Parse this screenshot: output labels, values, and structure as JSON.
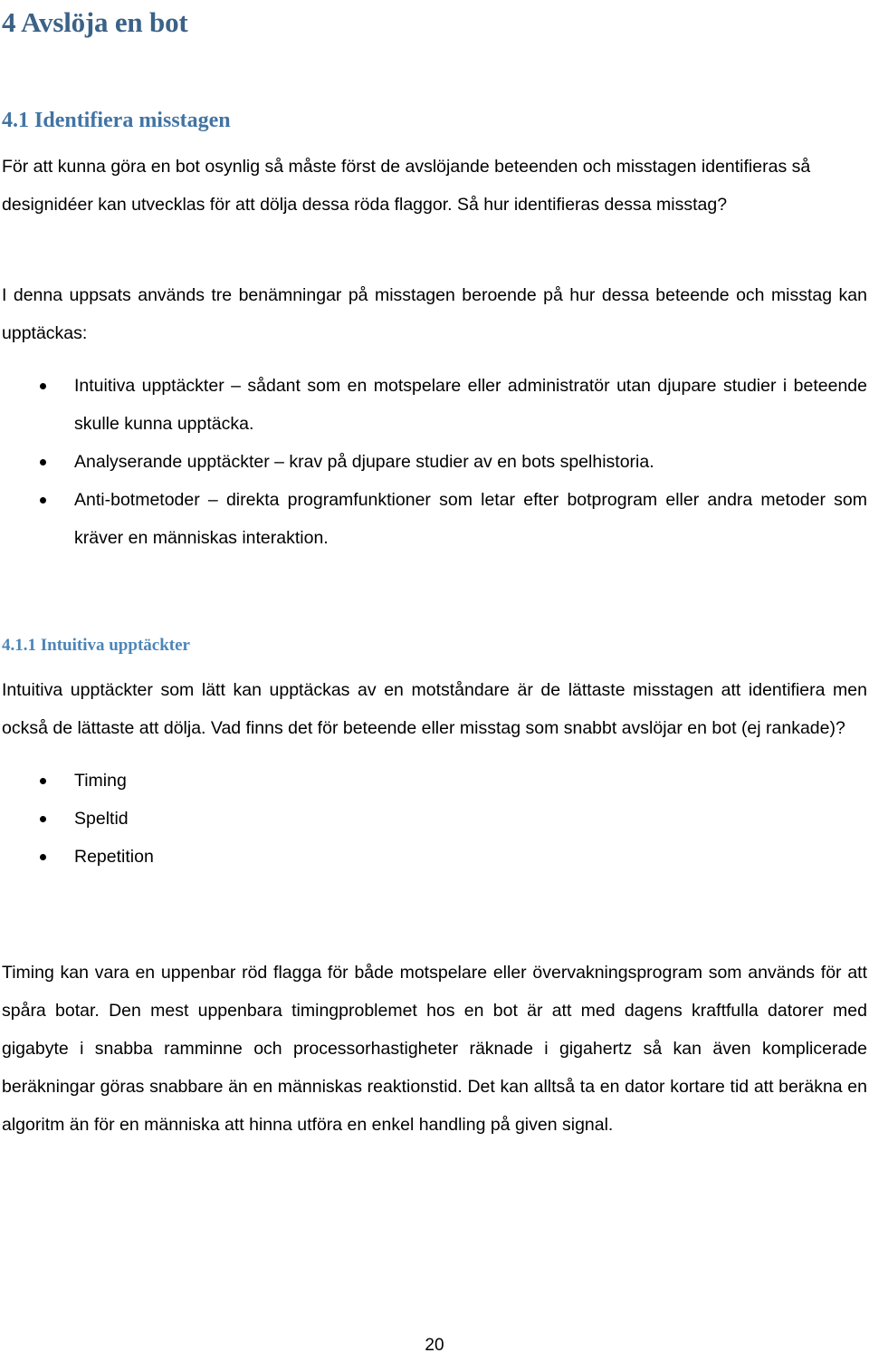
{
  "document": {
    "page_number": "20",
    "colors": {
      "heading_level1": "#3b6287",
      "heading_level2": "#4274a3",
      "heading_level3": "#4c85b8",
      "body_text": "#000000",
      "page_background": "#ffffff"
    }
  },
  "headings": {
    "chapter": "4 Avslöja en bot",
    "section": "4.1 Identifiera misstagen",
    "subsection": "4.1.1 Intuitiva upptäckter"
  },
  "paragraphs": {
    "intro": "För att kunna göra en bot osynlig så måste först de avslöjande beteenden och misstagen identifieras så designidéer kan utvecklas för att dölja dessa röda flaggor. Så hur identifieras dessa misstag?",
    "terms_lead": "I denna uppsats används tre benämningar på misstagen beroende på hur dessa beteende och misstag kan upptäckas:",
    "intuitive_intro": "Intuitiva upptäckter som lätt kan upptäckas av en motståndare är de lättaste misstagen att identifiera men också de lättaste att dölja. Vad finns det för beteende eller misstag som snabbt avslöjar en bot (ej rankade)?",
    "timing_discussion": "Timing kan vara en uppenbar röd flagga för både motspelare eller övervakningsprogram som används för att spåra botar. Den mest uppenbara timingproblemet hos en bot är att med dagens kraftfulla datorer med gigabyte i snabba ramminne och processorhastigheter räknade i gigahertz så kan även komplicerade beräkningar göras snabbare än en människas reaktionstid. Det kan alltså ta en dator kortare tid att beräkna en algoritm än för en människa att hinna utföra en enkel handling på given signal."
  },
  "lists": {
    "detection_types": [
      "Intuitiva upptäckter – sådant som en motspelare eller administratör utan djupare studier i beteende skulle kunna upptäcka.",
      "Analyserande upptäckter – krav på djupare studier av en bots spelhistoria.",
      "Anti-botmetoder – direkta programfunktioner som letar efter botprogram eller andra metoder som kräver en människas interaktion."
    ],
    "intuitive_signals": [
      "Timing",
      "Speltid",
      "Repetition"
    ]
  }
}
